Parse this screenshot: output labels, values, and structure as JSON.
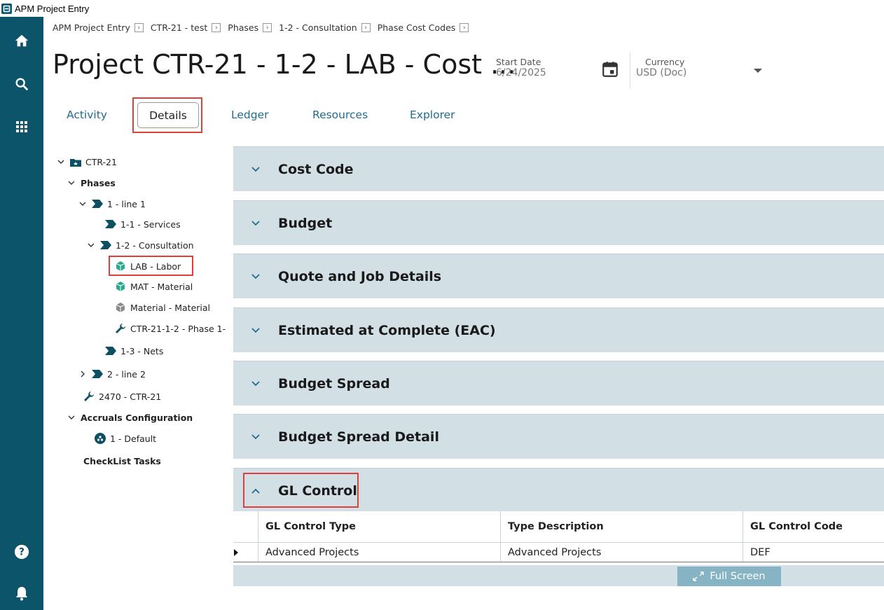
{
  "window": {
    "title": "APM Project Entry"
  },
  "breadcrumb": [
    {
      "label": "APM Project Entry"
    },
    {
      "label": "CTR-21 - test"
    },
    {
      "label": "Phases"
    },
    {
      "label": "1-2 - Consultation"
    },
    {
      "label": "Phase Cost Codes"
    }
  ],
  "header": {
    "title": "Project CTR-21 - 1-2 - LAB - Cost ...",
    "start_date_label": "Start Date",
    "start_date_value": "6/24/2025",
    "currency_label": "Currency",
    "currency_value": "USD (Doc)"
  },
  "tabs": {
    "activity": "Activity",
    "details": "Details",
    "ledger": "Ledger",
    "resources": "Resources",
    "explorer": "Explorer",
    "selected": "Details"
  },
  "tree": {
    "root": "CTR-21",
    "phases": "Phases",
    "line1": "1 - line 1",
    "services": "1-1 - Services",
    "consultation": "1-2 - Consultation",
    "labor": "LAB - Labor",
    "mat": "MAT - Material",
    "material": "Material - Material",
    "phase_item": "CTR-21-1-2 - Phase 1-",
    "nets": "1-3 - Nets",
    "line2": "2 - line 2",
    "ctr_item": "2470 - CTR-21",
    "accruals": "Accruals Configuration",
    "default": "1 - Default",
    "checklist": "CheckList Tasks"
  },
  "sections": {
    "cost_code": "Cost Code",
    "budget": "Budget",
    "quote": "Quote and Job Details",
    "eac": "Estimated at Complete (EAC)",
    "budget_spread": "Budget Spread",
    "budget_spread_detail": "Budget Spread Detail",
    "gl_control": "GL Control"
  },
  "gl_grid": {
    "columns": [
      "GL Control Type",
      "Type Description",
      "GL Control Code"
    ],
    "rows": [
      [
        "Advanced Projects",
        "Advanced Projects",
        "DEF"
      ]
    ],
    "full_screen_label": "Full Screen"
  },
  "colors": {
    "rail": "#0c5469",
    "section_bg": "#d2e0e5",
    "tab_link": "#1f6d8c",
    "highlight_border": "#e0403c",
    "tree_icon": "#0d4f63",
    "tree_icon_green": "#2aa890"
  },
  "icons": {
    "rail": [
      "home-icon",
      "search-icon",
      "grid-icon",
      "help-icon",
      "bell-icon"
    ]
  }
}
